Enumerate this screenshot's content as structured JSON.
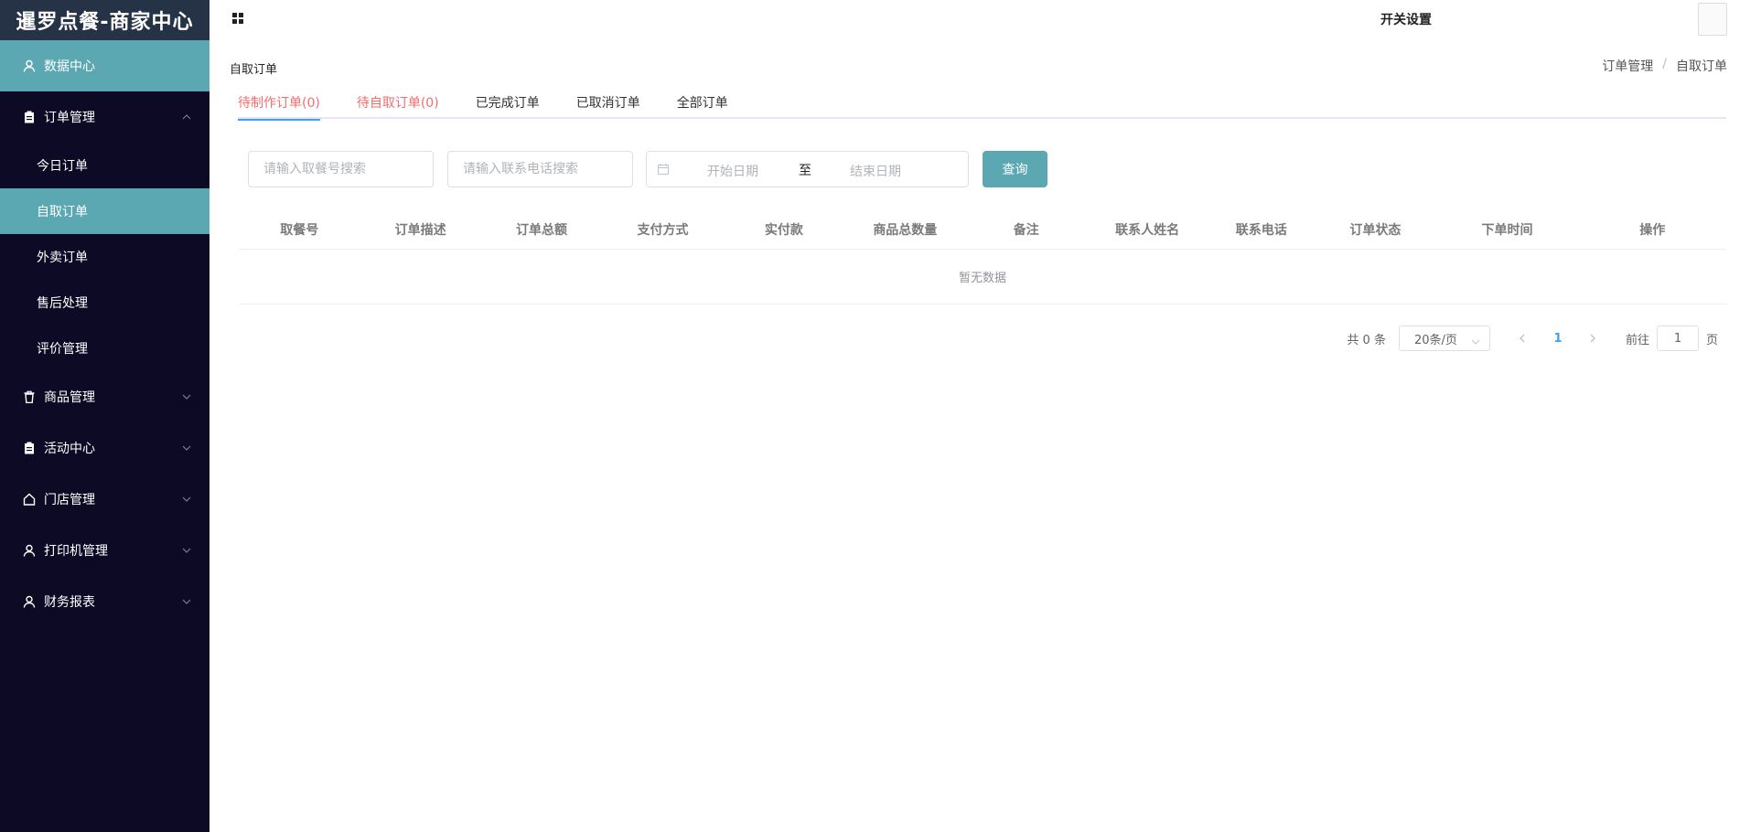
{
  "app": {
    "title": "暹罗点餐-商家中心"
  },
  "sidebar": {
    "items": [
      {
        "label": "数据中心",
        "icon": "user-icon",
        "active": true
      },
      {
        "label": "订单管理",
        "icon": "clipboard-icon",
        "expanded": true,
        "children": [
          {
            "label": "今日订单"
          },
          {
            "label": "自取订单",
            "active": true
          },
          {
            "label": "外卖订单"
          },
          {
            "label": "售后处理"
          },
          {
            "label": "评价管理"
          }
        ]
      },
      {
        "label": "商品管理",
        "icon": "trash-icon"
      },
      {
        "label": "活动中心",
        "icon": "clipboard-icon"
      },
      {
        "label": "门店管理",
        "icon": "home-icon"
      },
      {
        "label": "打印机管理",
        "icon": "user-icon"
      },
      {
        "label": "财务报表",
        "icon": "user-icon"
      }
    ]
  },
  "header": {
    "switch_settings": "开关设置"
  },
  "page": {
    "title": "自取订单",
    "breadcrumb": {
      "parent": "订单管理",
      "separator": "/",
      "current": "自取订单"
    }
  },
  "tabs": [
    {
      "label": "待制作订单(0)",
      "color": "#f56c6c",
      "active": true
    },
    {
      "label": "待自取订单(0)",
      "color": "#f56c6c"
    },
    {
      "label": "已完成订单"
    },
    {
      "label": "已取消订单"
    },
    {
      "label": "全部订单"
    }
  ],
  "search": {
    "pickup_placeholder": "请输入取餐号搜索",
    "phone_placeholder": "请输入联系电话搜索",
    "date_start_placeholder": "开始日期",
    "date_separator": "至",
    "date_end_placeholder": "结束日期",
    "query_label": "查询"
  },
  "table": {
    "columns": [
      "取餐号",
      "订单描述",
      "订单总额",
      "支付方式",
      "实付款",
      "商品总数量",
      "备注",
      "联系人姓名",
      "联系电话",
      "订单状态",
      "下单时间",
      "操作"
    ],
    "empty_text": "暂无数据"
  },
  "pagination": {
    "total": "共 0 条",
    "page_size": "20条/页",
    "current_page": "1",
    "goto_label": "前往",
    "goto_value": "1",
    "page_suffix": "页"
  },
  "colors": {
    "sidebar_bg": "#0c0a25",
    "logo_bg": "#263246",
    "accent": "#5ba8b2",
    "tab_red": "#f56c6c",
    "link_blue": "#409eff"
  }
}
